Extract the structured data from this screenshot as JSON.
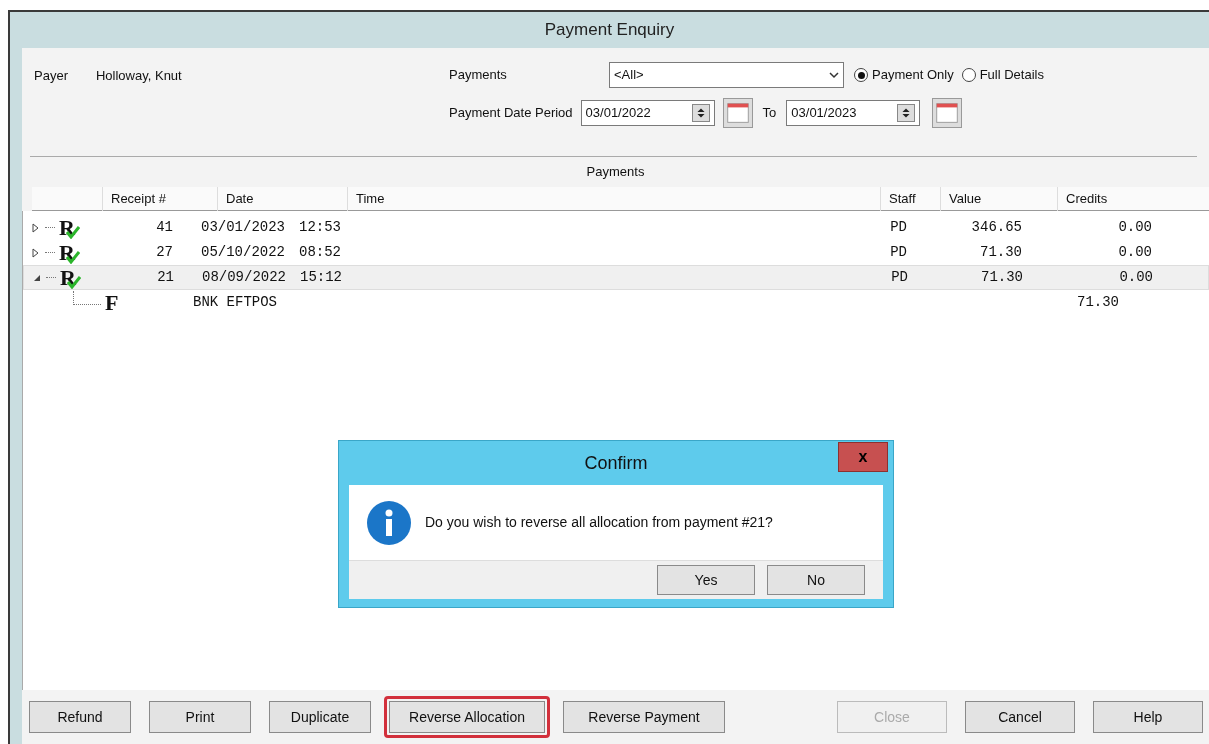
{
  "window": {
    "title": "Payment Enquiry"
  },
  "payer": {
    "label": "Payer",
    "name": "Holloway, Knut"
  },
  "filters": {
    "payments_label": "Payments",
    "payments_value": "<All>",
    "view_options": [
      {
        "label": "Payment Only",
        "selected": true
      },
      {
        "label": "Full Details",
        "selected": false
      }
    ],
    "period_label": "Payment Date Period",
    "from": "03/01/2022",
    "to_label": "To",
    "to": "03/01/2023"
  },
  "list": {
    "title": "Payments",
    "columns": [
      "Receipt #",
      "Date",
      "Time",
      "Staff",
      "Value",
      "Credits"
    ],
    "rows": [
      {
        "icon_letter": "R",
        "receipt": "41",
        "date": "03/01/2023",
        "time": "12:53",
        "staff": "PD",
        "value": "346.65",
        "credits": "0.00",
        "expanded": false,
        "selected": false
      },
      {
        "icon_letter": "R",
        "receipt": "27",
        "date": "05/10/2022",
        "time": "08:52",
        "staff": "PD",
        "value": "71.30",
        "credits": "0.00",
        "expanded": false,
        "selected": false
      },
      {
        "icon_letter": "R",
        "receipt": "21",
        "date": "08/09/2022",
        "time": "15:12",
        "staff": "PD",
        "value": "71.30",
        "credits": "0.00",
        "expanded": true,
        "selected": true,
        "children": [
          {
            "icon_letter": "F",
            "description": "BNK EFTPOS",
            "value": "71.30"
          }
        ]
      }
    ]
  },
  "buttons": [
    {
      "label": "Refund",
      "disabled": false,
      "highlighted": false
    },
    {
      "label": "Print",
      "disabled": false,
      "highlighted": false
    },
    {
      "label": "Duplicate",
      "disabled": false,
      "highlighted": false
    },
    {
      "label": "Reverse Allocation",
      "disabled": false,
      "highlighted": true
    },
    {
      "label": "Reverse Payment",
      "disabled": false,
      "highlighted": false
    },
    {
      "label": "Close",
      "disabled": true,
      "highlighted": false
    },
    {
      "label": "Cancel",
      "disabled": false,
      "highlighted": false
    },
    {
      "label": "Help",
      "disabled": false,
      "highlighted": false
    }
  ],
  "dialog": {
    "title": "Confirm",
    "close": "x",
    "message": "Do you wish to reverse all allocation from payment #21?",
    "buttons": [
      "Yes",
      "No"
    ]
  }
}
